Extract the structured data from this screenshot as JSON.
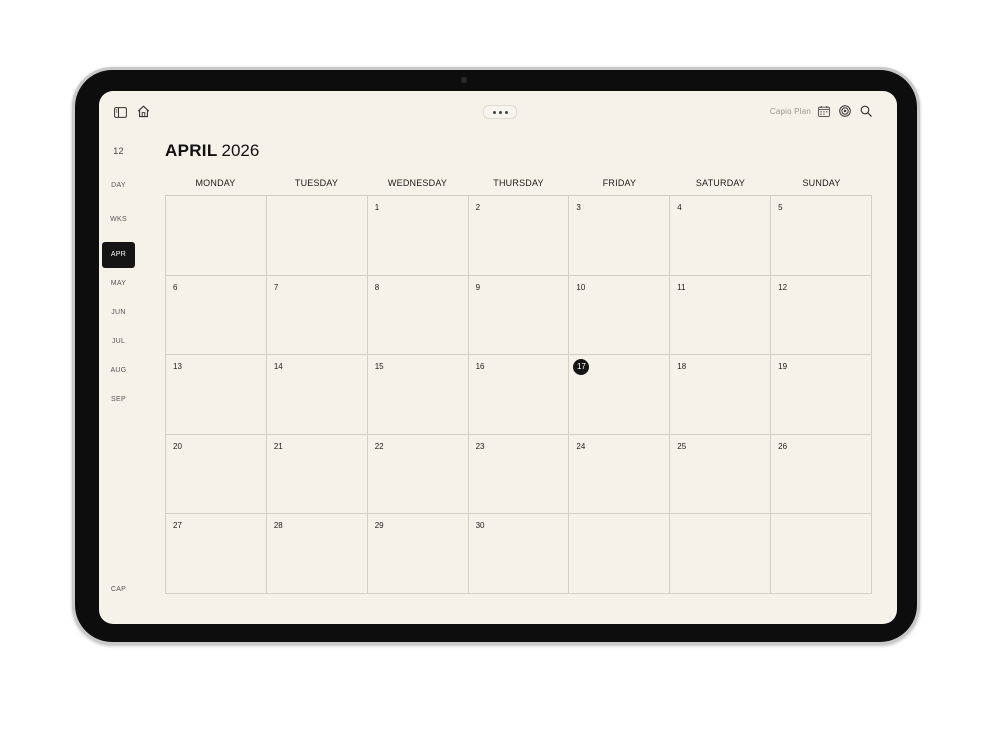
{
  "topbar": {
    "app_name": "Capio Plan",
    "sidebar_icon": "sidebar-toggle-icon",
    "home_icon": "home-icon",
    "more_icon": "more-dots-icon",
    "calendar_icon": "calendar-icon",
    "target_icon": "target-icon",
    "search_icon": "search-icon"
  },
  "nav": {
    "day_number": "12",
    "day": "DAY",
    "weeks": "WKS",
    "months": [
      "APR",
      "MAY",
      "JUN",
      "JUL",
      "AUG",
      "SEP"
    ],
    "active": "APR",
    "cap": "CAP"
  },
  "heading": {
    "month": "APRIL",
    "year": "2026"
  },
  "calendar": {
    "weekdays": [
      "MONDAY",
      "TUESDAY",
      "WEDNESDAY",
      "THURSDAY",
      "FRIDAY",
      "SATURDAY",
      "SUNDAY"
    ],
    "weeks": [
      [
        "",
        "",
        "1",
        "2",
        "3",
        "4",
        "5"
      ],
      [
        "6",
        "7",
        "8",
        "9",
        "10",
        "11",
        "12"
      ],
      [
        "13",
        "14",
        "15",
        "16",
        "17",
        "18",
        "19"
      ],
      [
        "20",
        "21",
        "22",
        "23",
        "24",
        "25",
        "26"
      ],
      [
        "27",
        "28",
        "29",
        "30",
        "",
        "",
        ""
      ]
    ],
    "today": "17"
  },
  "colors": {
    "background": "#f5f2e9",
    "accent": "#151515",
    "grid_line": "#d3cfc5"
  }
}
